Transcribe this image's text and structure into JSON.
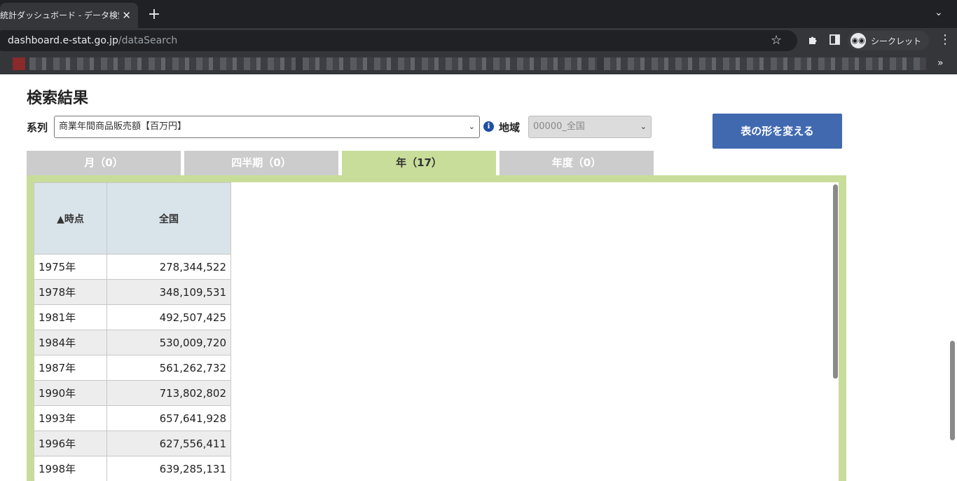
{
  "browser": {
    "tab_title": "統計ダッシュボード - データ検索",
    "tab_close": "✕",
    "new_tab": "+",
    "url_host": "dashboard.e-stat.go.jp",
    "url_path": "/dataSearch",
    "incognito_label": "シークレット"
  },
  "page": {
    "title": "検索結果",
    "series_label": "系列",
    "series_value": "商業年間商品販売額【百万円】",
    "region_label": "地域",
    "region_value": "00000_全国",
    "reshape_button": "表の形を変える"
  },
  "tabs": [
    {
      "label": "月（0）",
      "active": false
    },
    {
      "label": "四半期（0）",
      "active": false
    },
    {
      "label": "年（17）",
      "active": true
    },
    {
      "label": "年度（0）",
      "active": false
    }
  ],
  "table": {
    "headers": [
      "▲時点",
      "全国"
    ],
    "rows": [
      {
        "year": "1975年",
        "value": "278,344,522"
      },
      {
        "year": "1978年",
        "value": "348,109,531"
      },
      {
        "year": "1981年",
        "value": "492,507,425"
      },
      {
        "year": "1984年",
        "value": "530,009,720"
      },
      {
        "year": "1987年",
        "value": "561,262,732"
      },
      {
        "year": "1990年",
        "value": "713,802,802"
      },
      {
        "year": "1993年",
        "value": "657,641,928"
      },
      {
        "year": "1996年",
        "value": "627,556,411"
      },
      {
        "year": "1998年",
        "value": "639,285,131"
      }
    ]
  },
  "icons": {
    "lock": "lock-icon",
    "star": "star-icon",
    "extensions": "puzzle-icon",
    "sidepanel": "sidepanel-icon",
    "incognito": "incognito-icon",
    "menu": "kebab-menu-icon",
    "info": "info-icon",
    "caret": "chevron-down-icon"
  },
  "colors": {
    "accent_button": "#4169b0",
    "active_tab": "#c8dd9a",
    "inactive_tab": "#cccccc",
    "table_header": "#d9e3ea"
  }
}
